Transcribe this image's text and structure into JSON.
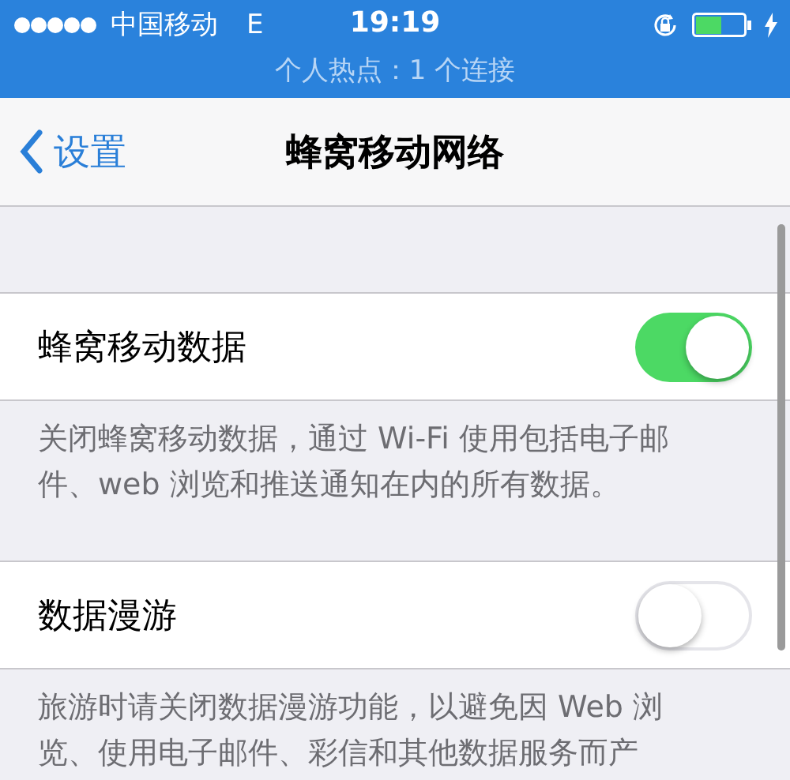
{
  "status_bar": {
    "carrier": "中国移动",
    "network": "E",
    "time": "19:19",
    "hotspot": "个人热点：1 个连接"
  },
  "nav": {
    "back": "设置",
    "title": "蜂窝移动网络"
  },
  "sections": [
    {
      "label": "蜂窝移动数据",
      "on": true,
      "footer": "关闭蜂窝移动数据，通过 Wi-Fi 使用包括电子邮件、web 浏览和推送通知在内的所有数据。"
    },
    {
      "label": "数据漫游",
      "on": false,
      "footer": "旅游时请关闭数据漫游功能，以避免因 Web 浏览、使用电子邮件、彩信和其他数据服务而产"
    }
  ]
}
